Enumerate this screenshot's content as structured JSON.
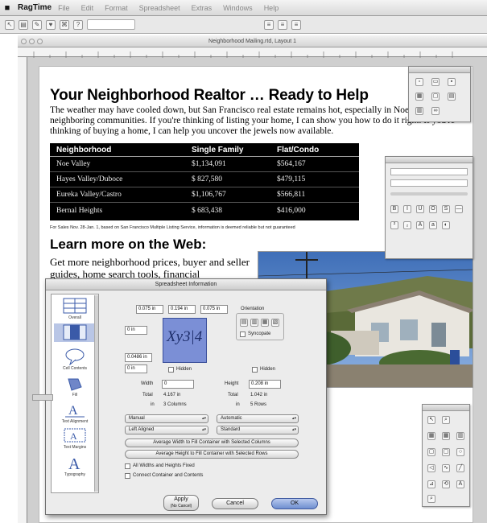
{
  "menubar": {
    "app_name": "RagTime",
    "items": [
      "File",
      "Edit",
      "Format",
      "Spreadsheet",
      "Extras",
      "Windows",
      "Help"
    ]
  },
  "window": {
    "title": "Neighborhood Mailing.rtd, Layout 1"
  },
  "document": {
    "headline": "Your Neighborhood Realtor … Ready to Help",
    "paragraph": "The weather may have cooled down, but San Francisco real estate remains hot, especially in Noe Valley and neighboring communities. If you're thinking of listing your home, I can show you how to do it right. If you're thinking of buying a home, I can help you uncover the jewels now available.",
    "table": {
      "headers": [
        "Neighborhood",
        "Single Family",
        "Flat/Condo"
      ],
      "rows": [
        [
          "Noe Valley",
          "$1,134,091",
          "$564,167"
        ],
        [
          "Hayes Valley/Duboce",
          "$ 827,580",
          "$479,115"
        ],
        [
          "Eureka Valley/Castro",
          "$1,106,767",
          "$566,811"
        ],
        [
          "Bernal Heights",
          "$ 683,438",
          "$416,000"
        ]
      ]
    },
    "footnote": "For Sales Nov. 28-Jan. 1, based on San Francisco Multiple Listing Service, information is deemed reliable but not guaranteed",
    "subheading": "Learn more on the Web:",
    "web_text": "Get more neighborhood prices, buyer and seller guides, home search tools, financial"
  },
  "dialog": {
    "title": "Spreadsheet Information",
    "sidebar": [
      "Overall",
      "Cell Contents",
      "Fill",
      "Text Alignment",
      "Text Margins",
      "Typography"
    ],
    "margins": {
      "top_left": "0.075 in",
      "top_mid": "0.194 in",
      "top_right": "0.075 in",
      "left_top": "0 in",
      "left_mid": "0.0486 in",
      "left_bottom": "0 in"
    },
    "preview_text": "Xy3|4",
    "hidden_label": "Hidden",
    "orientation_label": "Orientation",
    "sync_label": "Syncopate",
    "width_label": "Width",
    "width_value": "0",
    "total_label": "Total",
    "total_width": "4.167 in",
    "in_label": "in",
    "columns_count": "3 Columns",
    "height_label": "Height",
    "height_value": "0.208 in",
    "total_height": "1.042 in",
    "rows_count": "5 Rows",
    "popup_left_1": "Manual",
    "popup_right_1": "Automatic",
    "popup_left_2": "Left Aligned",
    "popup_right_2": "Standard",
    "btn_width": "Average Width to Fill Container with Selected Columns",
    "btn_height": "Average Height to Fill Container with Selected Rows",
    "check_fixed": "All Widths and Heights Fixed",
    "check_connect": "Connect Container and Contents",
    "apply_label": "Apply",
    "apply_sub": "(No Cancel)",
    "cancel_label": "Cancel",
    "ok_label": "OK"
  },
  "colors": {
    "table_bg": "#000000",
    "ok_button": "#8aa6d8",
    "preview_fill": "#7b8fd6"
  }
}
